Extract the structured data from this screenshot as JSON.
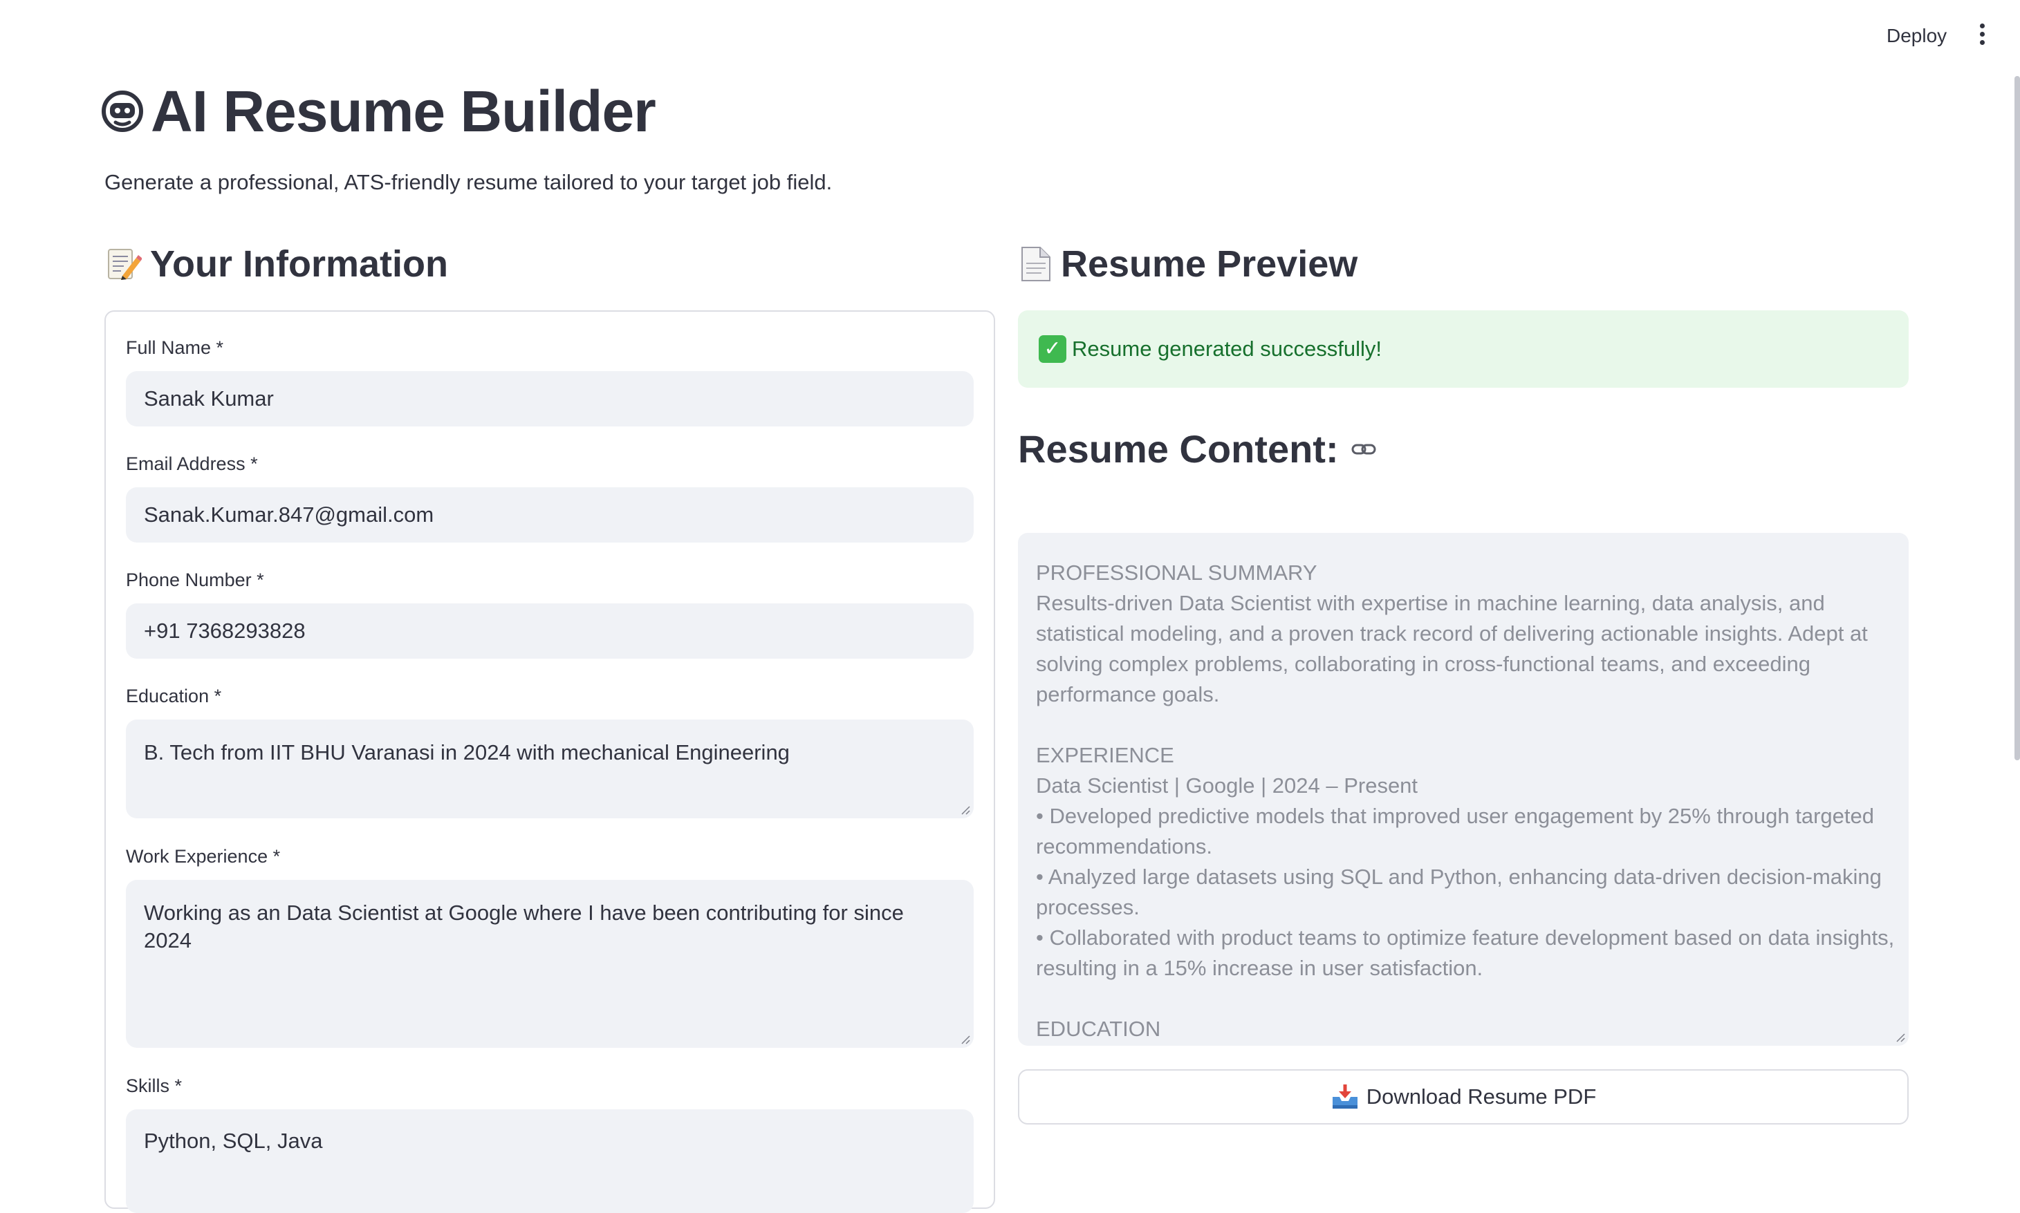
{
  "header": {
    "deploy_label": "Deploy",
    "menu_icon": "vertical-ellipsis-icon"
  },
  "page": {
    "title": "AI Resume Builder",
    "title_icon": "robot-face-icon",
    "subtitle": "Generate a professional, ATS-friendly resume tailored to your target job field."
  },
  "form": {
    "heading": "Your Information",
    "heading_icon": "memo-pencil-icon",
    "full_name": {
      "label": "Full Name *",
      "value": "Sanak Kumar"
    },
    "email": {
      "label": "Email Address *",
      "value": "Sanak.Kumar.847@gmail.com"
    },
    "phone": {
      "label": "Phone Number *",
      "value": "+91 7368293828"
    },
    "education": {
      "label": "Education *",
      "value": "B. Tech from IIT BHU Varanasi in 2024 with mechanical Engineering"
    },
    "experience": {
      "label": "Work Experience *",
      "value": "Working as an Data Scientist at Google where I have been contributing for since 2024"
    },
    "skills": {
      "label": "Skills *",
      "value": "Python, SQL, Java"
    }
  },
  "preview": {
    "heading": "Resume Preview",
    "heading_icon": "page-icon",
    "success_message": "Resume generated successfully!",
    "success_icon": "check-mark-icon",
    "content_heading": "Resume Content:",
    "content_link_icon": "link-icon",
    "resume_lines": [
      "PROFESSIONAL SUMMARY",
      "Results-driven Data Scientist with expertise in machine learning, data analysis, and",
      "statistical modeling, and a proven track record of delivering actionable insights. Adept at",
      "solving complex problems, collaborating in cross-functional teams, and exceeding",
      "performance goals.",
      "",
      "EXPERIENCE",
      "Data Scientist | Google | 2024 – Present",
      "• Developed predictive models that improved user engagement by 25% through targeted",
      "recommendations.",
      "• Analyzed large datasets using SQL and Python, enhancing data-driven decision-making",
      "processes.",
      "• Collaborated with product teams to optimize feature development based on data insights,",
      "resulting in a 15% increase in user satisfaction.",
      "",
      "EDUCATION"
    ],
    "download_label": "Download Resume PDF",
    "download_icon": "inbox-tray-icon"
  },
  "colors": {
    "text": "#31333f",
    "input_bg": "#f0f2f6",
    "success_bg": "#e8f8ea",
    "success_text": "#17702d",
    "border": "#dcdde3"
  }
}
